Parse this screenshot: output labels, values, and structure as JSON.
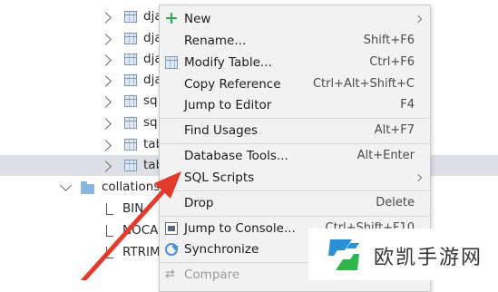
{
  "tree": {
    "tables": [
      {
        "label": "dja"
      },
      {
        "label": "dja"
      },
      {
        "label": "dja"
      },
      {
        "label": "dja"
      },
      {
        "label": "sq"
      },
      {
        "label": "sq"
      },
      {
        "label": "tab"
      },
      {
        "label": "tab"
      }
    ],
    "collations": {
      "label": "collations"
    },
    "collation_items": [
      {
        "label": "BIN"
      },
      {
        "label": "NOCA"
      },
      {
        "label": "RTRIM"
      }
    ]
  },
  "context_menu": {
    "items": [
      {
        "icon": "plus-icon",
        "label": "New",
        "shortcut": "",
        "submenu": true
      },
      {
        "icon": "",
        "label": "Rename...",
        "shortcut": "Shift+F6"
      },
      {
        "icon": "table-icon",
        "label": "Modify Table...",
        "shortcut": "Ctrl+F6"
      },
      {
        "icon": "",
        "label": "Copy Reference",
        "shortcut": "Ctrl+Alt+Shift+C"
      },
      {
        "icon": "",
        "label": "Jump to Editor",
        "shortcut": "F4"
      },
      {
        "icon": "",
        "label": "Find Usages",
        "shortcut": "Alt+F7"
      },
      {
        "icon": "",
        "label": "Database Tools...",
        "shortcut": "Alt+Enter"
      },
      {
        "icon": "",
        "label": "SQL Scripts",
        "shortcut": "",
        "submenu": true
      },
      {
        "icon": "",
        "label": "Drop",
        "shortcut": "Delete"
      },
      {
        "icon": "console-icon",
        "label": "Jump to Console...",
        "shortcut": "Ctrl+Shift+F10"
      },
      {
        "icon": "sync-icon",
        "label": "Synchronize",
        "shortcut": ""
      },
      {
        "icon": "compare-icon",
        "label": "Compare",
        "shortcut": "",
        "disabled": true
      }
    ]
  },
  "watermark": {
    "text": "欧凯手游网"
  },
  "colors": {
    "menu_bg": "#f2f2f2",
    "selected_row": "#dcdfe4",
    "arrow": "#e23b2e",
    "plus_icon": "#3aa657",
    "watermark_blue": "#2b8fd6",
    "watermark_green": "#2fb54a"
  }
}
